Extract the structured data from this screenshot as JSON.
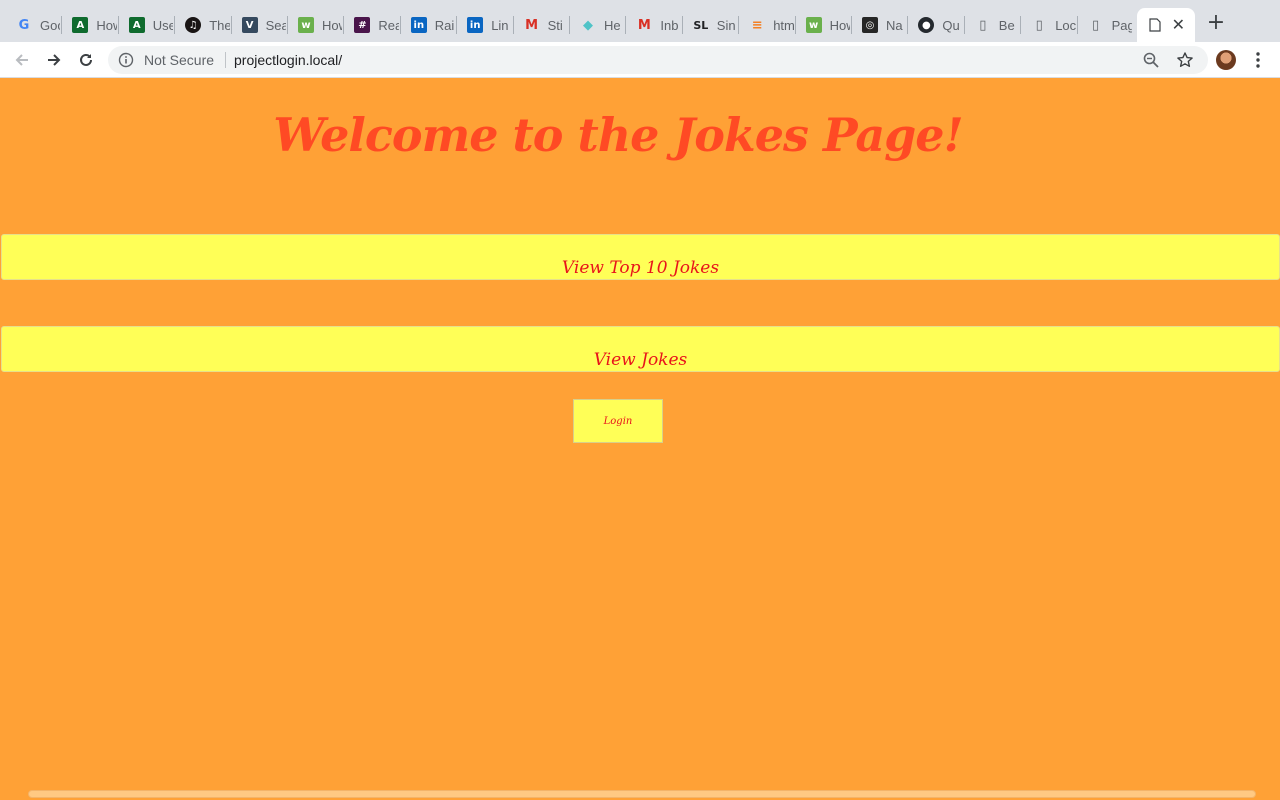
{
  "browser": {
    "tabs": [
      {
        "title": "Goo",
        "icon": "google-icon",
        "color": "#4285f4",
        "glyph": "G"
      },
      {
        "title": "How",
        "icon": "android-dev-icon",
        "color": "#0f6b2e",
        "glyph": "A"
      },
      {
        "title": "Use",
        "icon": "android-dev-icon",
        "color": "#0f6b2e",
        "glyph": "A"
      },
      {
        "title": "The",
        "icon": "spotify-icon",
        "color": "#191414",
        "glyph": "♫"
      },
      {
        "title": "Sea",
        "icon": "vue-icon",
        "color": "#35495e",
        "glyph": "V"
      },
      {
        "title": "How",
        "icon": "codepen-w3-icon",
        "color": "#6ab04c",
        "glyph": "w"
      },
      {
        "title": "Rea",
        "icon": "slack-icon",
        "color": "#4a154b",
        "glyph": "#"
      },
      {
        "title": "Rai",
        "icon": "linkedin-icon",
        "color": "#0a66c2",
        "glyph": "in"
      },
      {
        "title": "Lin",
        "icon": "linkedin-icon",
        "color": "#0a66c2",
        "glyph": "in"
      },
      {
        "title": "Sti",
        "icon": "gmail-icon",
        "color": "#d93025",
        "glyph": "M"
      },
      {
        "title": "He",
        "icon": "shield-icon",
        "color": "#4fc3c7",
        "glyph": "◆"
      },
      {
        "title": "Inb",
        "icon": "gmail-icon",
        "color": "#d93025",
        "glyph": "M"
      },
      {
        "title": "Sin",
        "icon": "sl-icon",
        "color": "#202124",
        "glyph": "SL"
      },
      {
        "title": "htm",
        "icon": "stackoverflow-icon",
        "color": "#f48024",
        "glyph": "≡"
      },
      {
        "title": "How",
        "icon": "codepen-w3-icon",
        "color": "#6ab04c",
        "glyph": "w"
      },
      {
        "title": "Na",
        "icon": "instagram-icon",
        "color": "#262626",
        "glyph": "◎"
      },
      {
        "title": "Qu",
        "icon": "github-icon",
        "color": "#24292e",
        "glyph": "●"
      },
      {
        "title": "Be",
        "icon": "page-icon",
        "color": "#5f6368",
        "glyph": "▯"
      },
      {
        "title": "Loc",
        "icon": "page-icon",
        "color": "#5f6368",
        "glyph": "▯"
      },
      {
        "title": "Pag",
        "icon": "page-icon",
        "color": "#5f6368",
        "glyph": "▯"
      }
    ],
    "active_tab_close": "✕",
    "new_tab": "+",
    "address": {
      "security_label": "Not Secure",
      "url": "projectlogin.local/"
    }
  },
  "page": {
    "heading": "Welcome to the Jokes Page!",
    "top_jokes_button": "View Top 10 Jokes",
    "view_jokes_button": "View Jokes",
    "login_button": "Login"
  },
  "colors": {
    "background": "#ffa136",
    "heading": "#ff4a24",
    "button_bg": "#ffff57",
    "button_text": "#e8141b"
  }
}
